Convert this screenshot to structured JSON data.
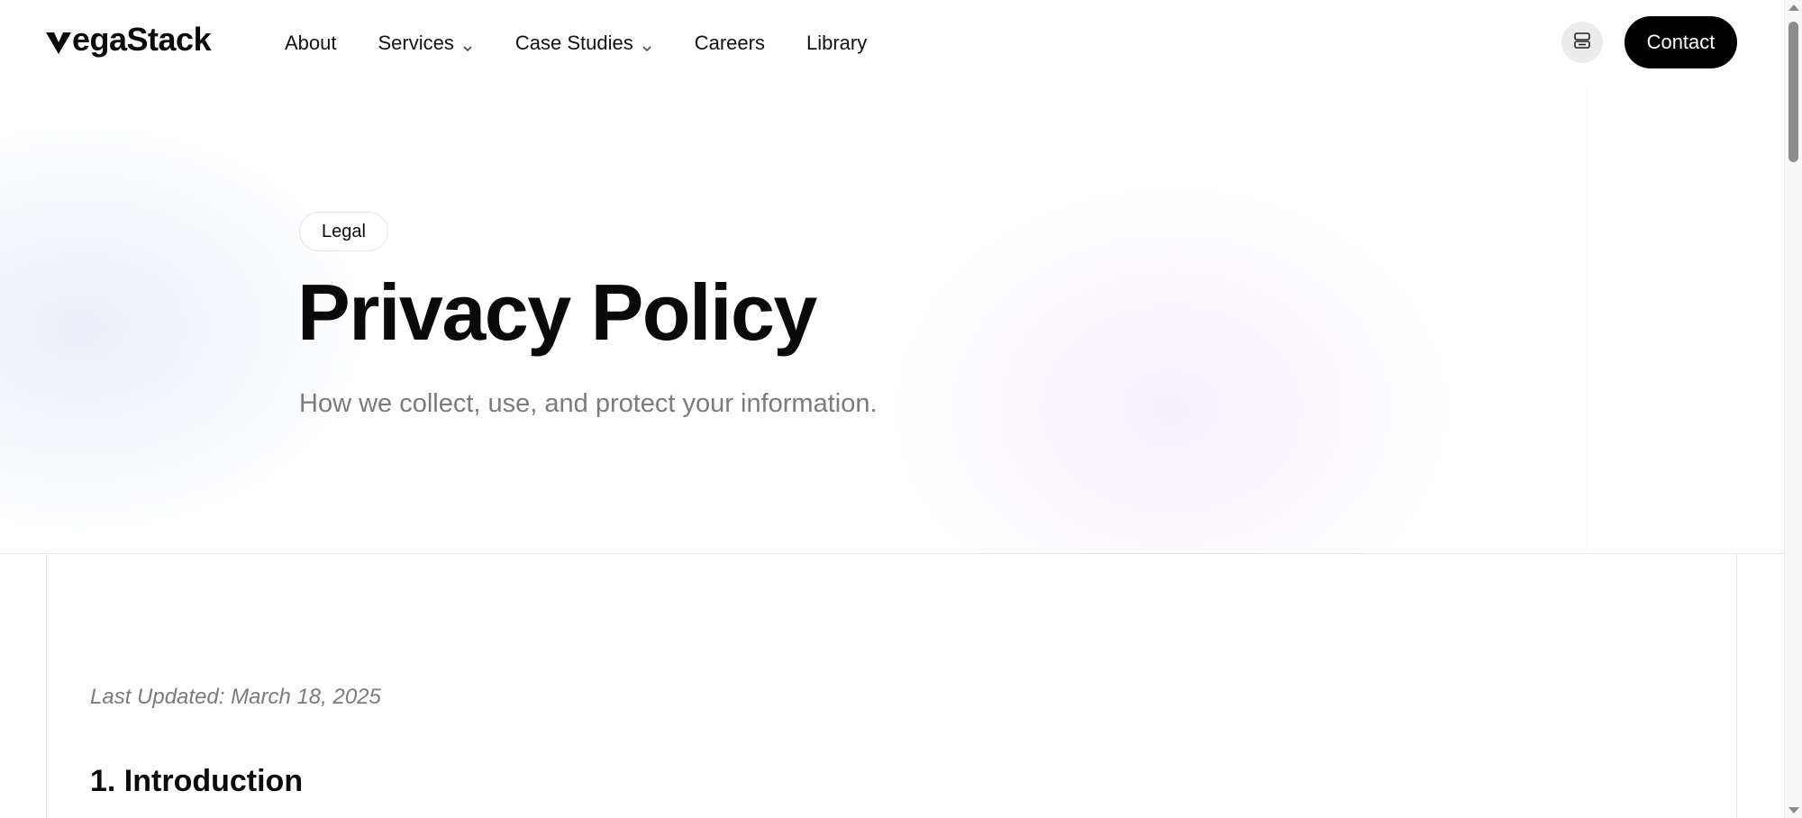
{
  "header": {
    "logo_text": "egaStack",
    "nav": [
      {
        "label": "About",
        "has_dropdown": false
      },
      {
        "label": "Services",
        "has_dropdown": true
      },
      {
        "label": "Case Studies",
        "has_dropdown": true
      },
      {
        "label": "Careers",
        "has_dropdown": false
      },
      {
        "label": "Library",
        "has_dropdown": false
      }
    ],
    "icon_button": "server-icon",
    "contact_label": "Contact"
  },
  "hero": {
    "badge": "Legal",
    "title": "Privacy Policy",
    "subtitle": "How we collect, use, and protect your information."
  },
  "content": {
    "last_updated": "Last Updated: March 18, 2025",
    "section_heading": "1. Introduction"
  },
  "colors": {
    "accent": "#000000",
    "muted_text": "#7b7b7b",
    "border": "#e6e6e6"
  }
}
